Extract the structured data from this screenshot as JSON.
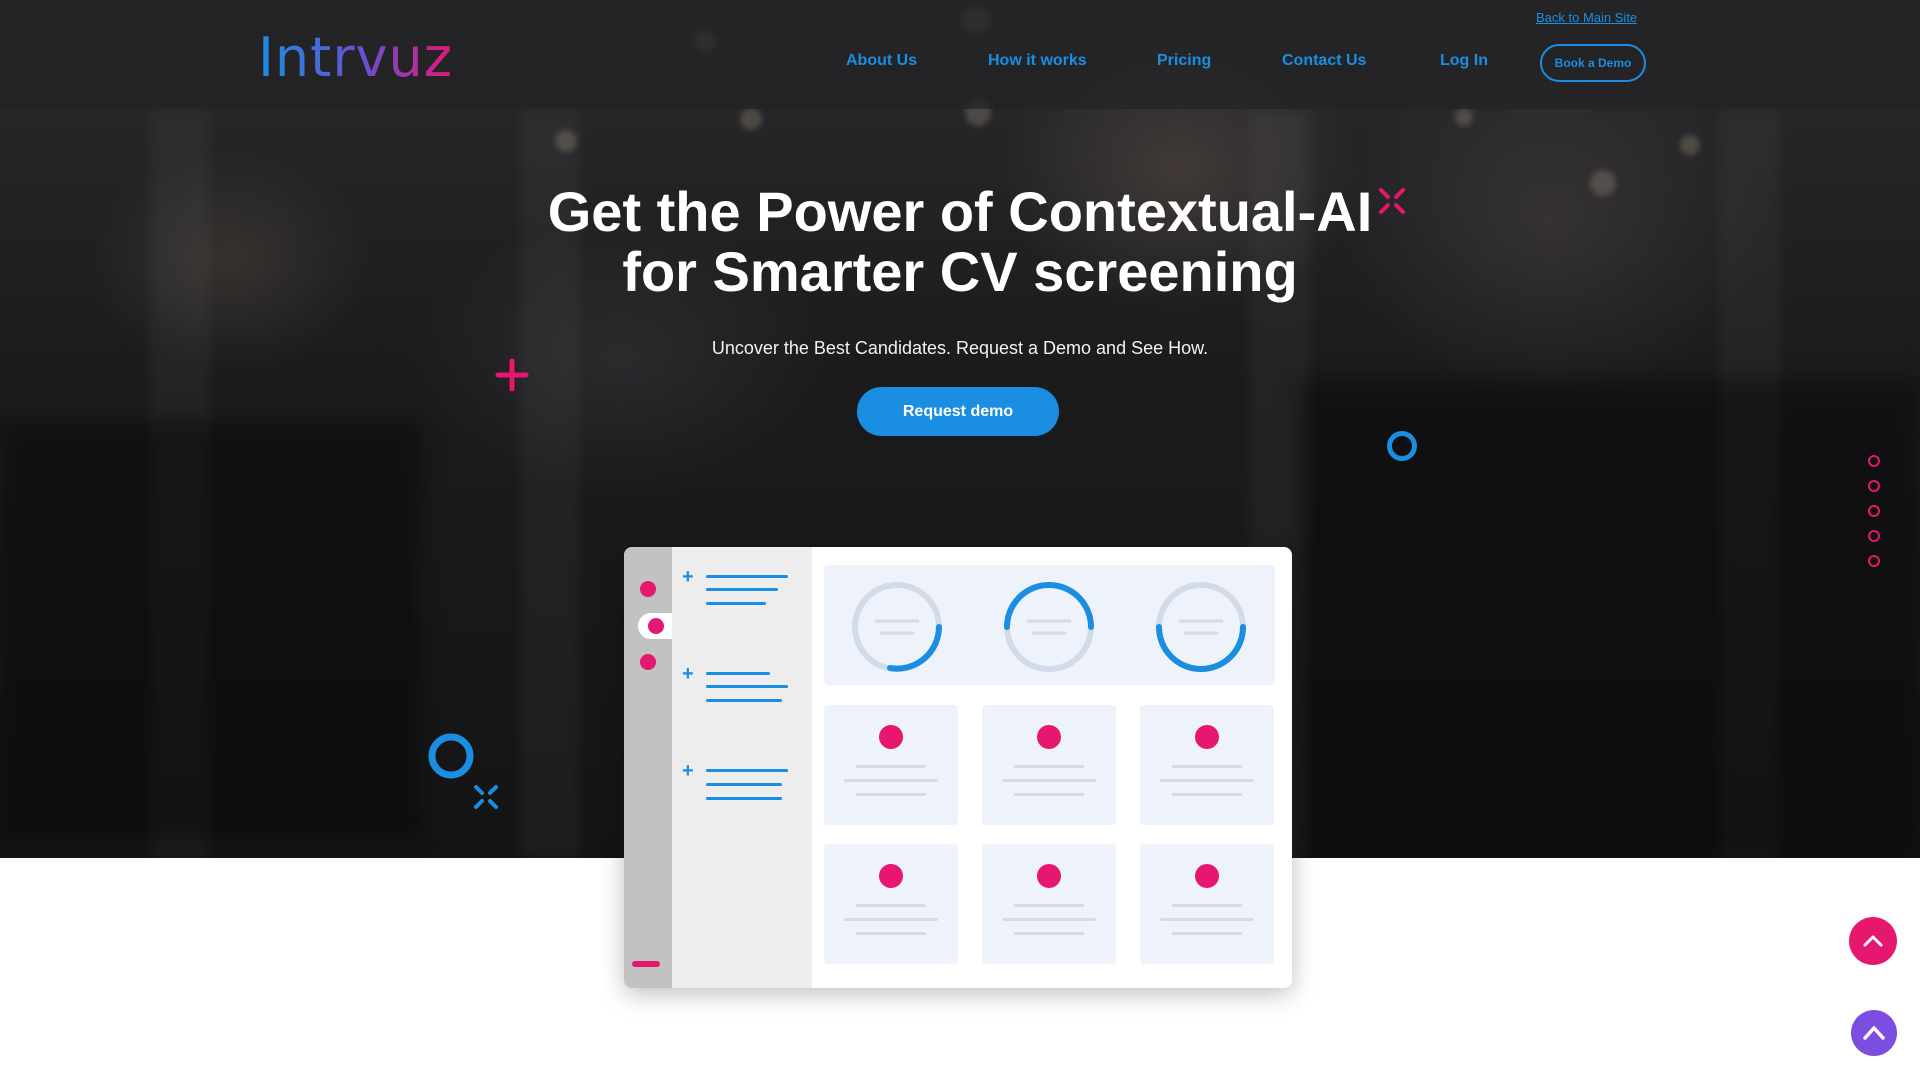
{
  "brand": {
    "logo_text": "Intrvuz",
    "accent": "#1a8ee0",
    "pink": "#e5176e",
    "purple": "#7b4ee0"
  },
  "header": {
    "back_link": "Back to Main Site",
    "nav": [
      "About Us",
      "How it works",
      "Pricing",
      "Contact Us",
      "Log In"
    ],
    "book_demo": "Book a Demo"
  },
  "hero": {
    "title_line1": "Get the Power of Contextual-AI",
    "title_line2": "for Smarter CV screening",
    "subtitle": "Uncover the Best Candidates. Request a Demo and See How.",
    "cta": "Request demo"
  },
  "icons": {
    "scroll_top_primary": "chevron-up-icon",
    "scroll_top_secondary": "chevron-up-icon"
  },
  "pager": {
    "count": 5
  }
}
